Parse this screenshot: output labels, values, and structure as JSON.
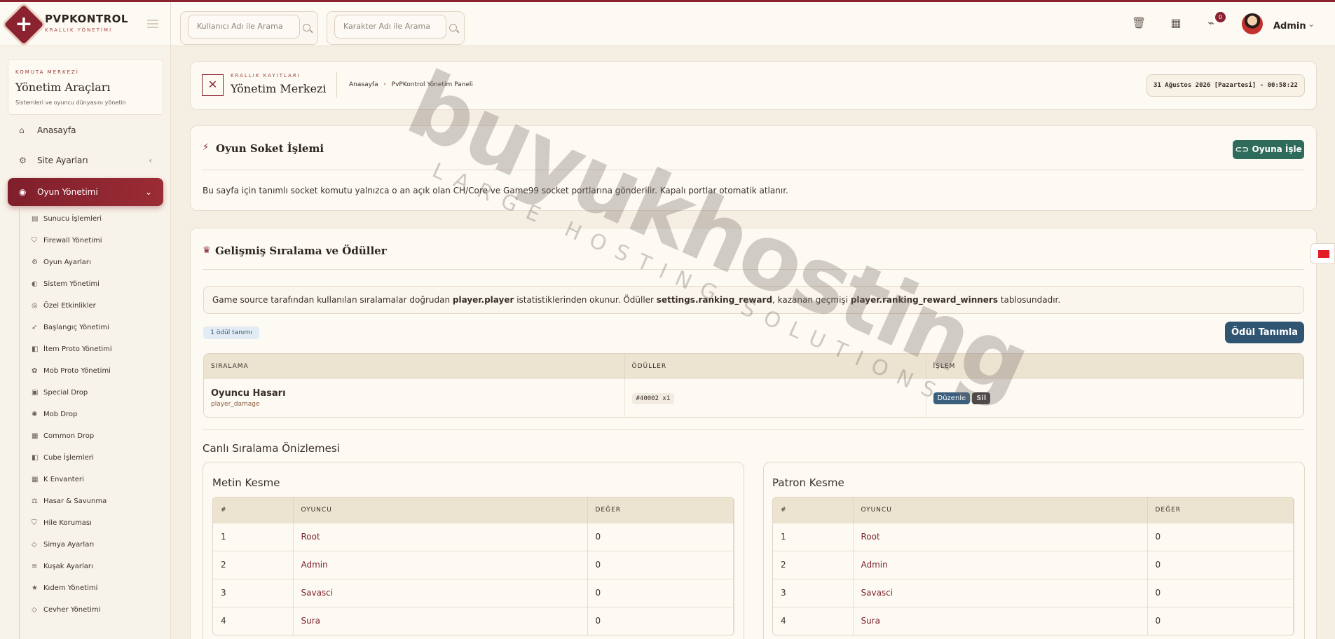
{
  "brand": {
    "name": "PVPKONTROL",
    "tagline": "KRALLIK YÖNETİMİ"
  },
  "search": {
    "user_placeholder": "Kullanıcı Adı ile Arama",
    "char_placeholder": "Karakter Adı ile Arama"
  },
  "header": {
    "notification_count": "0",
    "admin_name": "Admin"
  },
  "sidebar": {
    "card_kicker": "KOMUTA MERKEZİ",
    "card_title": "Yönetim Araçları",
    "card_sub": "Sistemleri ve oyuncu dünyasını yönetin",
    "main_items": [
      {
        "label": "Anasayfa"
      },
      {
        "label": "Site Ayarları"
      },
      {
        "label": "Oyun Yönetimi"
      }
    ],
    "sub_items": [
      "Sunucu İşlemleri",
      "Firewall Yönetimi",
      "Oyun Ayarları",
      "Sistem Yönetimi",
      "Özel Etkinlikler",
      "Başlangıç Yönetimi",
      "İtem Proto Yönetimi",
      "Mob Proto Yönetimi",
      "Special Drop",
      "Mob Drop",
      "Common Drop",
      "Cube İşlemleri",
      "K Envanteri",
      "Hasar & Savunma",
      "Hile Koruması",
      "Simya Ayarları",
      "Kuşak Ayarları",
      "Kıdem Yönetimi",
      "Cevher Yönetimi"
    ]
  },
  "page_header": {
    "kicker": "KRALLIK KAYITLARI",
    "title": "Yönetim Merkezi",
    "breadcrumb_home": "Anasayfa",
    "breadcrumb_current": "PvPKontrol Yönetim Paneli",
    "datetime": "31 Ağustos 2026 [Pazartesi] - 00:58:22"
  },
  "socket_card": {
    "title": "Oyun Soket İşlemi",
    "button": "Oyuna İşle",
    "description": "Bu sayfa için tanımlı socket komutu yalnızca o an açık olan CH/Core ve Game99 socket portlarına gönderilir. Kapalı portlar otomatik atlanır."
  },
  "ranking_card": {
    "title": "Gelişmiş Sıralama ve Ödüller",
    "info_pre": "Game source tarafından kullanılan sıralamalar doğrudan ",
    "info_b1": "player.player",
    "info_mid1": " istatistiklerinden okunur. Ödüller ",
    "info_b2": "settings.ranking_reward",
    "info_mid2": ", kazanan geçmişi ",
    "info_b3": "player.ranking_reward_winners",
    "info_post": " tablosundadır.",
    "count_badge": "1 ödül tanımı",
    "define_button": "Ödül Tanımla",
    "table_headers": [
      "SIRALAMA",
      "ÖDÜLLER",
      "İŞLEM"
    ],
    "rows": [
      {
        "name": "Oyuncu Hasarı",
        "key": "player_damage",
        "reward": "#40002 x1",
        "edit": "Düzenle",
        "delete": "Sil"
      }
    ],
    "preview_title": "Canlı Sıralama Önizlemesi"
  },
  "previews": [
    {
      "title": "Metin Kesme",
      "headers": [
        "#",
        "OYUNCU",
        "DEĞER"
      ],
      "rows": [
        {
          "rank": "1",
          "player": "Root",
          "value": "0"
        },
        {
          "rank": "2",
          "player": "Admin",
          "value": "0"
        },
        {
          "rank": "3",
          "player": "Savasci",
          "value": "0"
        },
        {
          "rank": "4",
          "player": "Sura",
          "value": "0"
        }
      ]
    },
    {
      "title": "Patron Kesme",
      "headers": [
        "#",
        "OYUNCU",
        "DEĞER"
      ],
      "rows": [
        {
          "rank": "1",
          "player": "Root",
          "value": "0"
        },
        {
          "rank": "2",
          "player": "Admin",
          "value": "0"
        },
        {
          "rank": "3",
          "player": "Savasci",
          "value": "0"
        },
        {
          "rank": "4",
          "player": "Sura",
          "value": "0"
        }
      ]
    }
  ],
  "watermark": {
    "big": "buyukhosting",
    "small": "LARGE HOSTING SOLUTIONS"
  },
  "colors": {
    "accent": "#8a2230",
    "green": "#2f6b5a",
    "blue": "#305573",
    "bg": "#f5efe3"
  }
}
